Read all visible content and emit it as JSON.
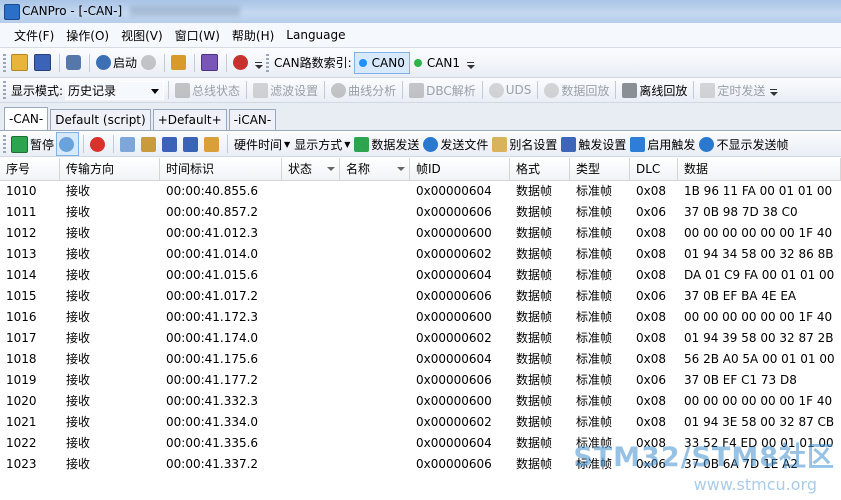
{
  "window": {
    "title": "CANPro - [-CAN-]"
  },
  "menu": [
    "文件(F)",
    "操作(O)",
    "视图(V)",
    "窗口(W)",
    "帮助(H)",
    "Language"
  ],
  "toolbar1": {
    "start_label": "启动",
    "can_index_label": "CAN路数索引:",
    "can0_label": "CAN0",
    "can1_label": "CAN1",
    "can0_color": "#1e90ff",
    "can1_color": "#2db34a"
  },
  "toolbar2": {
    "display_mode_label": "显示模式:",
    "display_mode_value": "历史记录",
    "bus_status": "总线状态",
    "filter_settings": "滤波设置",
    "curve_analysis": "曲线分析",
    "dbc_parse": "DBC解析",
    "uds": "UDS",
    "data_playback": "数据回放",
    "offline_playback": "离线回放",
    "timed_send": "定时发送"
  },
  "tabs": [
    "-CAN-",
    "Default (script)",
    "+Default+",
    "-iCAN-"
  ],
  "toolbar3": {
    "pause": "暂停",
    "hw_time": "硬件时间",
    "display_style": "显示方式",
    "data_send": "数据发送",
    "send_file": "发送文件",
    "alias_settings": "别名设置",
    "trigger_settings": "触发设置",
    "enable_trigger": "启用触发",
    "hide_sent": "不显示发送帧"
  },
  "table": {
    "columns": [
      "序号",
      "传输方向",
      "时间标识",
      "状态",
      "名称",
      "帧ID",
      "格式",
      "类型",
      "DLC",
      "数据"
    ],
    "rows": [
      [
        "1010",
        "接收",
        "00:00:40.855.6",
        "",
        "",
        "0x00000604",
        "数据帧",
        "标准帧",
        "0x08",
        "1B 96 11 FA 00 01 01 00"
      ],
      [
        "1011",
        "接收",
        "00:00:40.857.2",
        "",
        "",
        "0x00000606",
        "数据帧",
        "标准帧",
        "0x06",
        "37 0B 98 7D 38 C0"
      ],
      [
        "1012",
        "接收",
        "00:00:41.012.3",
        "",
        "",
        "0x00000600",
        "数据帧",
        "标准帧",
        "0x08",
        "00 00 00 00 00 00 1F 40"
      ],
      [
        "1013",
        "接收",
        "00:00:41.014.0",
        "",
        "",
        "0x00000602",
        "数据帧",
        "标准帧",
        "0x08",
        "01 94 34 58 00 32 86 8B"
      ],
      [
        "1014",
        "接收",
        "00:00:41.015.6",
        "",
        "",
        "0x00000604",
        "数据帧",
        "标准帧",
        "0x08",
        "DA 01 C9 FA 00 01 01 00"
      ],
      [
        "1015",
        "接收",
        "00:00:41.017.2",
        "",
        "",
        "0x00000606",
        "数据帧",
        "标准帧",
        "0x06",
        "37 0B EF BA 4E EA"
      ],
      [
        "1016",
        "接收",
        "00:00:41.172.3",
        "",
        "",
        "0x00000600",
        "数据帧",
        "标准帧",
        "0x08",
        "00 00 00 00 00 00 1F 40"
      ],
      [
        "1017",
        "接收",
        "00:00:41.174.0",
        "",
        "",
        "0x00000602",
        "数据帧",
        "标准帧",
        "0x08",
        "01 94 39 58 00 32 87 2B"
      ],
      [
        "1018",
        "接收",
        "00:00:41.175.6",
        "",
        "",
        "0x00000604",
        "数据帧",
        "标准帧",
        "0x08",
        "56 2B A0 5A 00 01 01 00"
      ],
      [
        "1019",
        "接收",
        "00:00:41.177.2",
        "",
        "",
        "0x00000606",
        "数据帧",
        "标准帧",
        "0x06",
        "37 0B EF C1 73 D8"
      ],
      [
        "1020",
        "接收",
        "00:00:41.332.3",
        "",
        "",
        "0x00000600",
        "数据帧",
        "标准帧",
        "0x08",
        "00 00 00 00 00 00 1F 40"
      ],
      [
        "1021",
        "接收",
        "00:00:41.334.0",
        "",
        "",
        "0x00000602",
        "数据帧",
        "标准帧",
        "0x08",
        "01 94 3E 58 00 32 87 CB"
      ],
      [
        "1022",
        "接收",
        "00:00:41.335.6",
        "",
        "",
        "0x00000604",
        "数据帧",
        "标准帧",
        "0x08",
        "33 52 F4 ED 00 01 01 00"
      ],
      [
        "1023",
        "接收",
        "00:00:41.337.2",
        "",
        "",
        "0x00000606",
        "数据帧",
        "标准帧",
        "0x06",
        "37 0B 6A 7D 1E A2"
      ]
    ]
  },
  "watermark": {
    "brand": "STM32/STM8社区",
    "url": "www.stmcu.org"
  }
}
